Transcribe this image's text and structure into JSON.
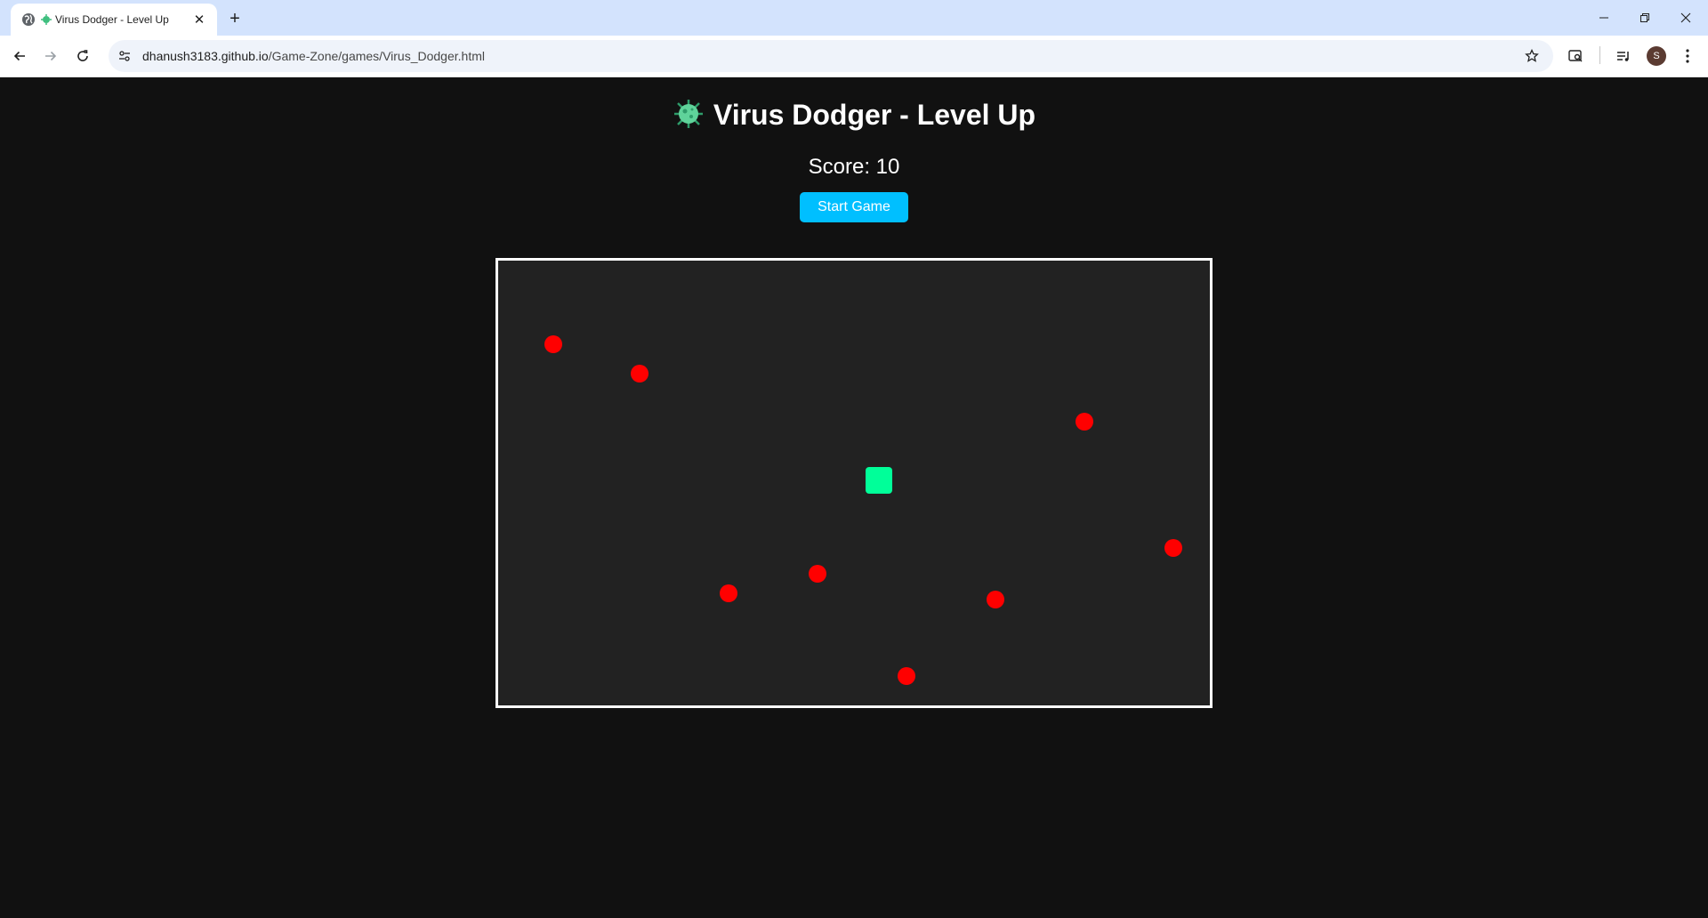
{
  "browser": {
    "tab_title": "Virus Dodger - Level Up",
    "url_host": "dhanush3183.github.io",
    "url_path": "/Game-Zone/games/Virus_Dodger.html",
    "profile_initial": "S"
  },
  "game": {
    "title": "Virus Dodger - Level Up",
    "score_label": "Score: 10",
    "start_button": "Start Game",
    "player_color": "#00ff99",
    "virus_color": "#ff0000",
    "board_color": "#222222",
    "accent_color": "#00bfff"
  }
}
